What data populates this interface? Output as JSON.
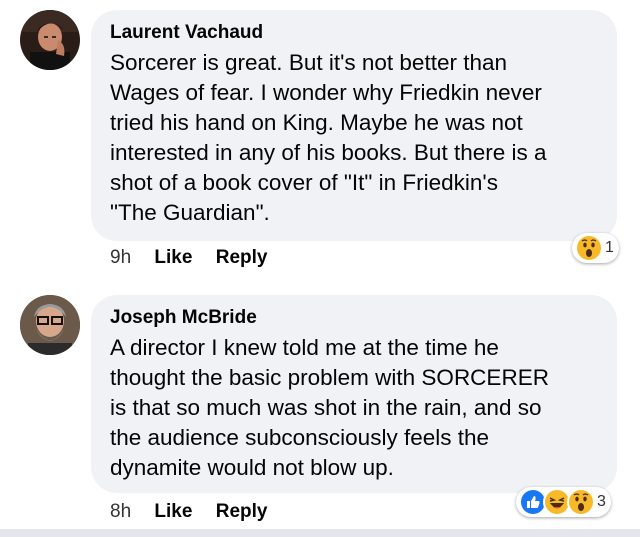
{
  "comments": [
    {
      "author": "Laurent Vachaud",
      "text": "Sorcerer is great. But it's not better than\nWages of fear. I wonder why Friedkin never\ntried his hand on King. Maybe he was not\ninterested in any of his books. But there is a\nshot of a book cover of \"It\" in Friedkin's\n\"The Guardian\".",
      "time": "9h",
      "like_label": "Like",
      "reply_label": "Reply",
      "reaction_count": "1",
      "reactions": [
        "wow-icon"
      ]
    },
    {
      "author": "Joseph McBride",
      "text": "A director I knew told me at the time he\nthought the basic problem with SORCERER\nis that so much was shot in the rain, and so\nthe audience subconsciously feels the\ndynamite would not blow up.",
      "time": "8h",
      "like_label": "Like",
      "reply_label": "Reply",
      "reaction_count": "3",
      "reactions": [
        "like-icon",
        "haha-icon",
        "wow-icon"
      ]
    }
  ],
  "colors": {
    "bubble": "#f0f2f5",
    "text": "#050505",
    "like_blue": "#1877f2",
    "emoji_yellow": "#f7b928"
  }
}
